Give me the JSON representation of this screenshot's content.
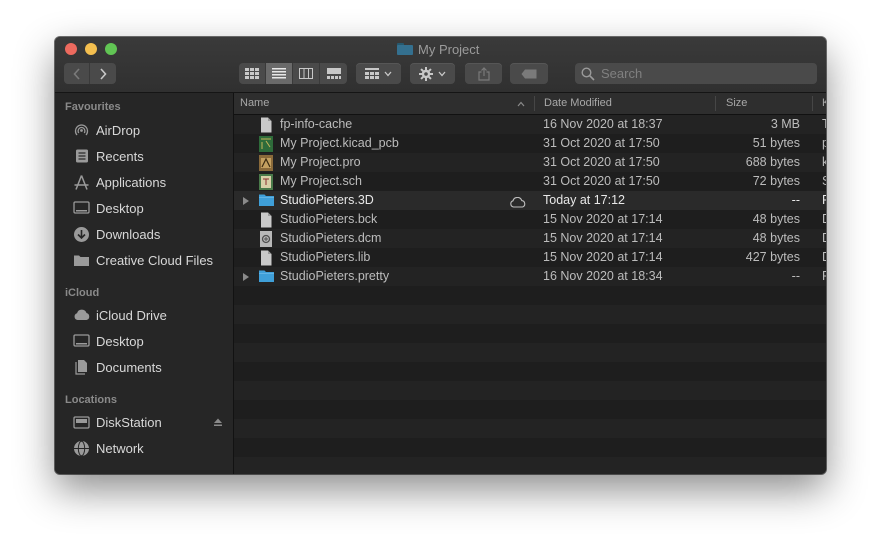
{
  "window": {
    "title": "My Project"
  },
  "toolbar": {
    "back_glyph": "‹",
    "forward_glyph": "›",
    "view_modes": [
      "icon-view",
      "list-view",
      "column-view",
      "gallery-view"
    ],
    "active_view": "list-view",
    "search_placeholder": "Search",
    "icons": [
      "chevron-left-icon",
      "chevron-right-icon",
      "grid-icon",
      "gear-icon",
      "share-icon",
      "tag-icon",
      "search-icon"
    ]
  },
  "sidebar": {
    "favourites_label": "Favourites",
    "favourites": [
      {
        "label": "AirDrop",
        "icon": "airdrop-icon"
      },
      {
        "label": "Recents",
        "icon": "recents-icon"
      },
      {
        "label": "Applications",
        "icon": "applications-icon"
      },
      {
        "label": "Desktop",
        "icon": "desktop-icon"
      },
      {
        "label": "Downloads",
        "icon": "downloads-icon"
      },
      {
        "label": "Creative Cloud Files",
        "icon": "folder-icon"
      }
    ],
    "icloud_label": "iCloud",
    "icloud": [
      {
        "label": "iCloud Drive",
        "icon": "icloud-icon"
      },
      {
        "label": "Desktop",
        "icon": "desktop-icon"
      },
      {
        "label": "Documents",
        "icon": "documents-icon"
      }
    ],
    "locations_label": "Locations",
    "locations": [
      {
        "label": "DiskStation",
        "icon": "nas-icon",
        "eject": true
      },
      {
        "label": "Network",
        "icon": "network-icon"
      }
    ]
  },
  "columns": {
    "name": "Name",
    "date": "Date Modified",
    "size": "Size",
    "kind": "K"
  },
  "files": [
    {
      "name": "fp-info-cache",
      "date": "16 Nov 2020 at 18:37",
      "size": "3 MB",
      "kind": "T",
      "icon": "document-icon",
      "folder": false
    },
    {
      "name": "My Project.kicad_pcb",
      "date": "31 Oct 2020 at 17:50",
      "size": "51 bytes",
      "kind": "p",
      "icon": "kicad-pcb-icon",
      "folder": false
    },
    {
      "name": "My Project.pro",
      "date": "31 Oct 2020 at 17:50",
      "size": "688 bytes",
      "kind": "k",
      "icon": "kicad-pro-icon",
      "folder": false
    },
    {
      "name": "My Project.sch",
      "date": "31 Oct 2020 at 17:50",
      "size": "72 bytes",
      "kind": "S",
      "icon": "kicad-sch-icon",
      "folder": false
    },
    {
      "name": "StudioPieters.3D",
      "date": "Today at 17:12",
      "size": "--",
      "kind": "F",
      "icon": "folder-icon",
      "folder": true,
      "cloud": true,
      "highlight": true
    },
    {
      "name": "StudioPieters.bck",
      "date": "15 Nov 2020 at 17:14",
      "size": "48 bytes",
      "kind": "D",
      "icon": "document-icon",
      "folder": false
    },
    {
      "name": "StudioPieters.dcm",
      "date": "15 Nov 2020 at 17:14",
      "size": "48 bytes",
      "kind": "D",
      "icon": "dcm-icon",
      "folder": false
    },
    {
      "name": "StudioPieters.lib",
      "date": "15 Nov 2020 at 17:14",
      "size": "427 bytes",
      "kind": "D",
      "icon": "document-icon",
      "folder": false
    },
    {
      "name": "StudioPieters.pretty",
      "date": "16 Nov 2020 at 18:34",
      "size": "--",
      "kind": "F",
      "icon": "folder-icon",
      "folder": true
    }
  ],
  "colors": {
    "accent": "#3f9fd8",
    "bg": "#1e1e1e",
    "sidebar": "#262626"
  }
}
